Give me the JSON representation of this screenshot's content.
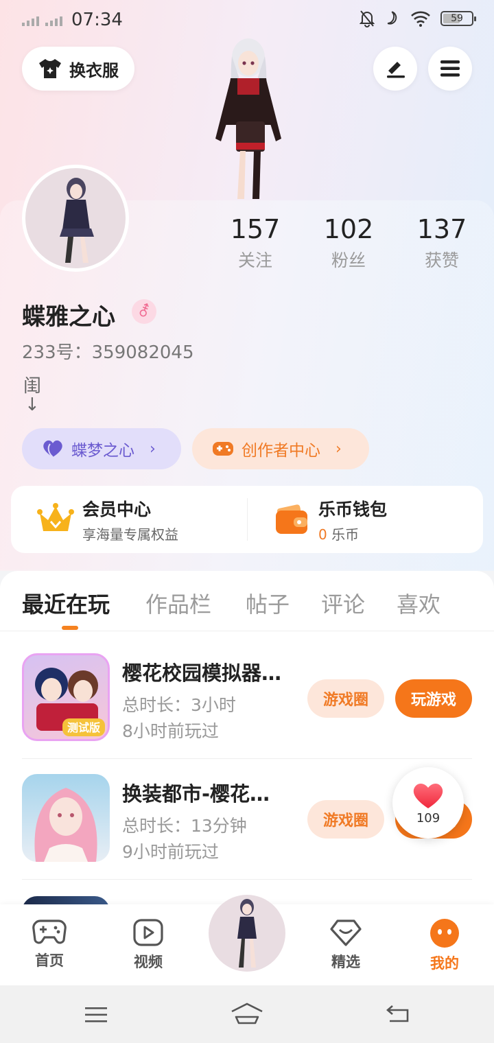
{
  "status_bar": {
    "time": "07:34",
    "battery": "59"
  },
  "header": {
    "outfit_label": "换衣服"
  },
  "profile": {
    "username": "蝶雅之心",
    "gender_symbol": "⚦",
    "uid": "233号：359082045",
    "bio_line1": "闺",
    "bio_line2": "↓",
    "stats": [
      {
        "num": "157",
        "label": "关注"
      },
      {
        "num": "102",
        "label": "粉丝"
      },
      {
        "num": "137",
        "label": "获赞"
      }
    ],
    "pill_purple": "蝶梦之心",
    "pill_orange": "创作者中心"
  },
  "vip": {
    "member_title": "会员中心",
    "member_sub": "享海量专属权益",
    "wallet_title": "乐币钱包",
    "wallet_amount": "0",
    "wallet_unit": " 乐币"
  },
  "tabs": [
    "最近在玩",
    "作品栏",
    "帖子",
    "评论",
    "喜欢"
  ],
  "games": [
    {
      "title": "樱花校园模拟器…",
      "duration": "总时长：3小时",
      "last_played": "8小时前玩过",
      "circle_btn": "游戏圈",
      "play_btn": "玩游戏",
      "badge": "测试版"
    },
    {
      "title": "换装都市-樱花…",
      "duration": "总时长：13分钟",
      "last_played": "9小时前玩过",
      "circle_btn": "游戏圈",
      "play_btn": "玩游戏"
    }
  ],
  "heart": {
    "count": "109"
  },
  "bottom_nav": [
    {
      "label": "首页"
    },
    {
      "label": "视频"
    },
    {
      "label": "精选"
    },
    {
      "label": "我的"
    }
  ],
  "colors": {
    "accent": "#f5761a",
    "purple": "#6b5bd0"
  }
}
